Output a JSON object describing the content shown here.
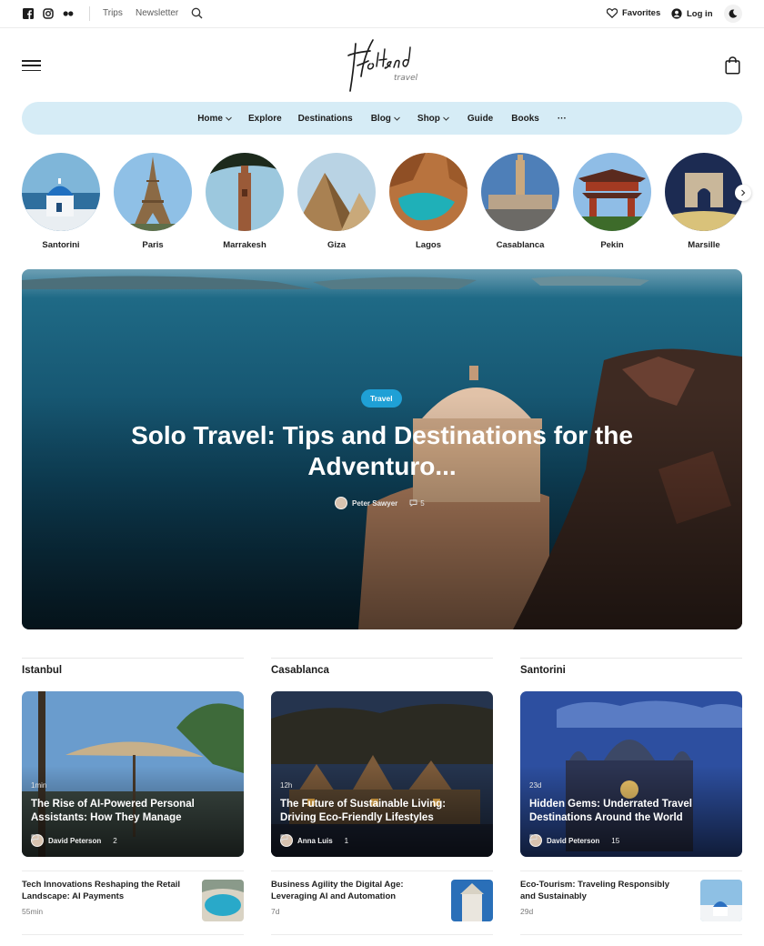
{
  "topbar": {
    "social": [
      "facebook-icon",
      "instagram-icon",
      "flickr-icon"
    ],
    "links": [
      "Trips",
      "Newsletter"
    ],
    "favorites_label": "Favorites",
    "login_label": "Log in"
  },
  "logo": {
    "main": "Holland",
    "sub": "travel"
  },
  "nav": {
    "items": [
      {
        "label": "Home",
        "dropdown": true
      },
      {
        "label": "Explore",
        "dropdown": false
      },
      {
        "label": "Destinations",
        "dropdown": false
      },
      {
        "label": "Blog",
        "dropdown": true
      },
      {
        "label": "Shop",
        "dropdown": true
      },
      {
        "label": "Guide",
        "dropdown": false
      },
      {
        "label": "Books",
        "dropdown": false
      }
    ],
    "more_label": "···"
  },
  "destinations": [
    {
      "name": "Santorini"
    },
    {
      "name": "Paris"
    },
    {
      "name": "Marrakesh"
    },
    {
      "name": "Giza"
    },
    {
      "name": "Lagos"
    },
    {
      "name": "Casablanca"
    },
    {
      "name": "Pekin"
    },
    {
      "name": "Marsille"
    }
  ],
  "hero": {
    "badge": "Travel",
    "title": "Solo Travel: Tips and Destinations for the Adventuro...",
    "author": "Peter Sawyer",
    "comments": "5"
  },
  "columns": [
    {
      "title": "Istanbul",
      "card": {
        "age": "1min",
        "title": "The Rise of AI-Powered Personal Assistants: How They Manage",
        "author": "David Peterson",
        "comments": "2"
      },
      "mini": {
        "title": "Tech Innovations Reshaping the Retail Landscape: AI Payments",
        "age": "55min"
      }
    },
    {
      "title": "Casablanca",
      "card": {
        "age": "12h",
        "title": "The Future of Sustainable Living: Driving Eco-Friendly Lifestyles",
        "author": "Anna Luis",
        "comments": "1"
      },
      "mini": {
        "title": "Business Agility the Digital Age: Leveraging AI and Automation",
        "age": "7d"
      }
    },
    {
      "title": "Santorini",
      "card": {
        "age": "23d",
        "title": "Hidden Gems: Underrated Travel Destinations Around the World",
        "author": "David Peterson",
        "comments": "15"
      },
      "mini": {
        "title": "Eco-Tourism: Traveling Responsibly and Sustainably",
        "age": "29d"
      }
    }
  ],
  "colors": {
    "nav_bg": "#d6ecf6",
    "badge": "#1fa0d6",
    "text": "#1b1b1b"
  }
}
